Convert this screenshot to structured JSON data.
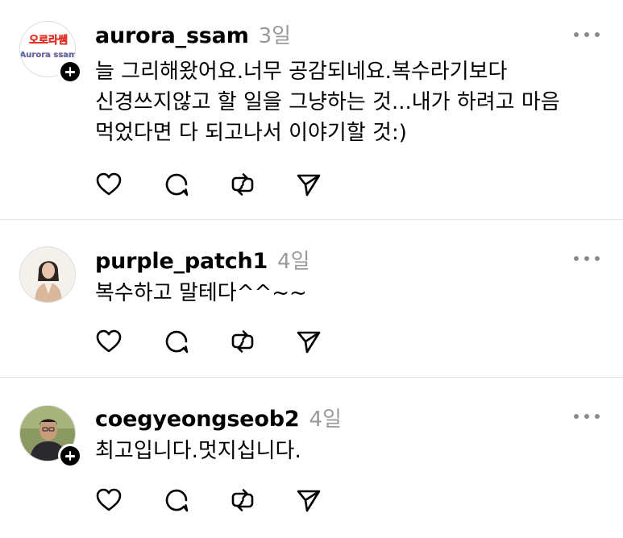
{
  "posts": [
    {
      "username": "aurora_ssam",
      "time": "3일",
      "text": "늘 그리해왔어요.너무 공감되네요.복수라기보다 신경쓰지않고 할 일을 그냥하는 것...내가 하려고  마음  먹었다면 다 되고나서 이야기할 것:)",
      "avatar_logo_line1": "오로라쌤",
      "avatar_logo_line2": "Aurora ssam",
      "has_follow_badge": true
    },
    {
      "username": "purple_patch1",
      "time": "4일",
      "text": "복수하고 말테다^^~~",
      "has_follow_badge": false
    },
    {
      "username": "coegyeongseob2",
      "time": "4일",
      "text": "최고입니다.멋지십니다.",
      "has_follow_badge": true
    }
  ],
  "icons": {
    "like": "heart-icon",
    "reply": "comment-icon",
    "repost": "repost-icon",
    "share": "send-icon",
    "more": "more-icon",
    "follow": "plus-icon"
  },
  "colors": {
    "text": "#000000",
    "timestamp": "#9a9a9a",
    "divider": "#e6e6e6",
    "more_dots": "#8a8a8a"
  }
}
